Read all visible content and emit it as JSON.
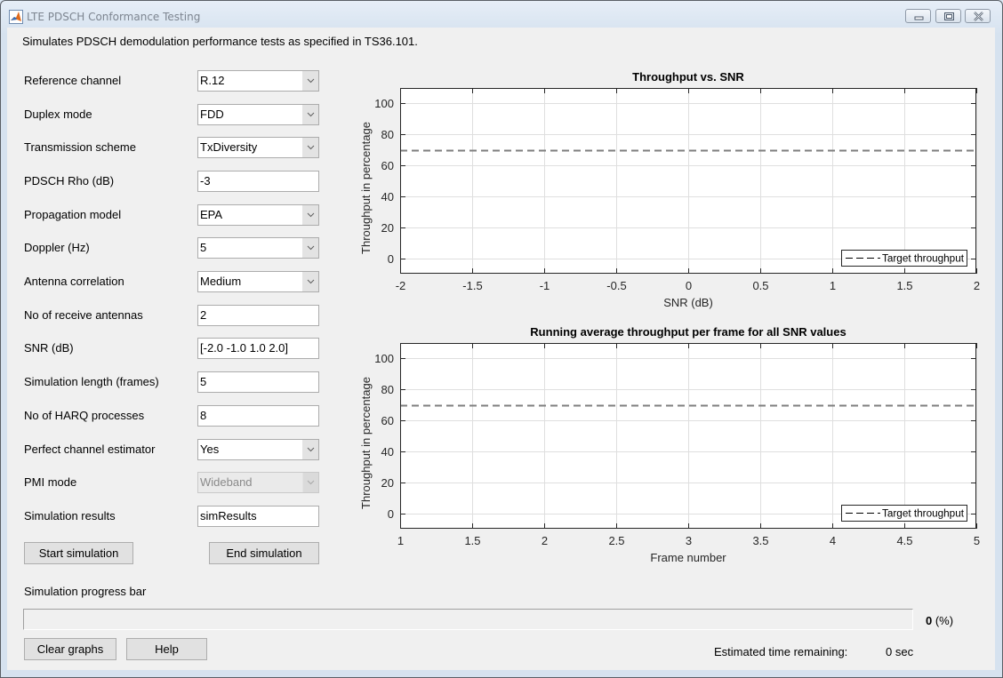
{
  "window": {
    "title": "LTE PDSCH Conformance Testing",
    "controls": {
      "minimize": "minimize",
      "maximize": "maximize",
      "close": "close"
    }
  },
  "description": "Simulates PDSCH demodulation performance tests as specified in TS36.101.",
  "params": [
    {
      "label": "Reference channel",
      "type": "select",
      "value": "R.12",
      "enabled": true
    },
    {
      "label": "Duplex mode",
      "type": "select",
      "value": "FDD",
      "enabled": true
    },
    {
      "label": "Transmission scheme",
      "type": "select",
      "value": "TxDiversity",
      "enabled": true
    },
    {
      "label": "PDSCH Rho (dB)",
      "type": "text",
      "value": "-3",
      "enabled": true
    },
    {
      "label": "Propagation model",
      "type": "select",
      "value": "EPA",
      "enabled": true
    },
    {
      "label": "Doppler (Hz)",
      "type": "select",
      "value": "5",
      "enabled": true
    },
    {
      "label": "Antenna correlation",
      "type": "select",
      "value": "Medium",
      "enabled": true
    },
    {
      "label": "No of receive antennas",
      "type": "text",
      "value": "2",
      "enabled": true
    },
    {
      "label": "SNR (dB)",
      "type": "text",
      "value": "[-2.0 -1.0 1.0 2.0]",
      "enabled": true
    },
    {
      "label": "Simulation length (frames)",
      "type": "text",
      "value": "5",
      "enabled": true
    },
    {
      "label": "No of HARQ processes",
      "type": "text",
      "value": "8",
      "enabled": true
    },
    {
      "label": "Perfect channel estimator",
      "type": "select",
      "value": "Yes",
      "enabled": true
    },
    {
      "label": "PMI mode",
      "type": "select",
      "value": "Wideband",
      "enabled": false
    },
    {
      "label": "Simulation results",
      "type": "text",
      "value": "simResults",
      "enabled": true
    }
  ],
  "buttons": {
    "start": "Start simulation",
    "end": "End simulation",
    "clear": "Clear graphs",
    "help": "Help"
  },
  "progress": {
    "label": "Simulation progress bar",
    "percent": 0,
    "percent_text": "0",
    "percent_unit": " (%)",
    "eta_label": "Estimated time remaining:",
    "eta_value": "0 sec"
  },
  "colors": {
    "target_line": "#7f7f7f",
    "grid": "#dfdfdf",
    "axes": "#262626"
  },
  "chart_data": [
    {
      "type": "line",
      "title": "Throughput vs. SNR",
      "xlabel": "SNR (dB)",
      "ylabel": "Throughput in percentage",
      "xlim": [
        -2,
        2
      ],
      "ylim": [
        -10,
        110
      ],
      "xticks": [
        -2,
        -1.5,
        -1,
        -0.5,
        0,
        0.5,
        1,
        1.5,
        2
      ],
      "xtick_labels": [
        "-2",
        "-1.5",
        "-1",
        "-0.5",
        "0",
        "0.5",
        "1",
        "1.5",
        "2"
      ],
      "yticks": [
        0,
        20,
        40,
        60,
        80,
        100
      ],
      "ytick_labels": [
        "0",
        "20",
        "40",
        "60",
        "80",
        "100"
      ],
      "grid": true,
      "legend": {
        "entries": [
          "Target throughput"
        ],
        "location": "bottom-right"
      },
      "series": [
        {
          "name": "Target throughput",
          "style": "dashed",
          "x": [
            -2,
            2
          ],
          "y": [
            70,
            70
          ]
        }
      ]
    },
    {
      "type": "line",
      "title": "Running average throughput per frame for all SNR values",
      "xlabel": "Frame number",
      "ylabel": "Throughput in percentage",
      "xlim": [
        1,
        5
      ],
      "ylim": [
        -10,
        110
      ],
      "xticks": [
        1,
        1.5,
        2,
        2.5,
        3,
        3.5,
        4,
        4.5,
        5
      ],
      "xtick_labels": [
        "1",
        "1.5",
        "2",
        "2.5",
        "3",
        "3.5",
        "4",
        "4.5",
        "5"
      ],
      "yticks": [
        0,
        20,
        40,
        60,
        80,
        100
      ],
      "ytick_labels": [
        "0",
        "20",
        "40",
        "60",
        "80",
        "100"
      ],
      "grid": true,
      "legend": {
        "entries": [
          "Target throughput"
        ],
        "location": "bottom-right"
      },
      "series": [
        {
          "name": "Target throughput",
          "style": "dashed",
          "x": [
            1,
            5
          ],
          "y": [
            70,
            70
          ]
        }
      ]
    }
  ]
}
